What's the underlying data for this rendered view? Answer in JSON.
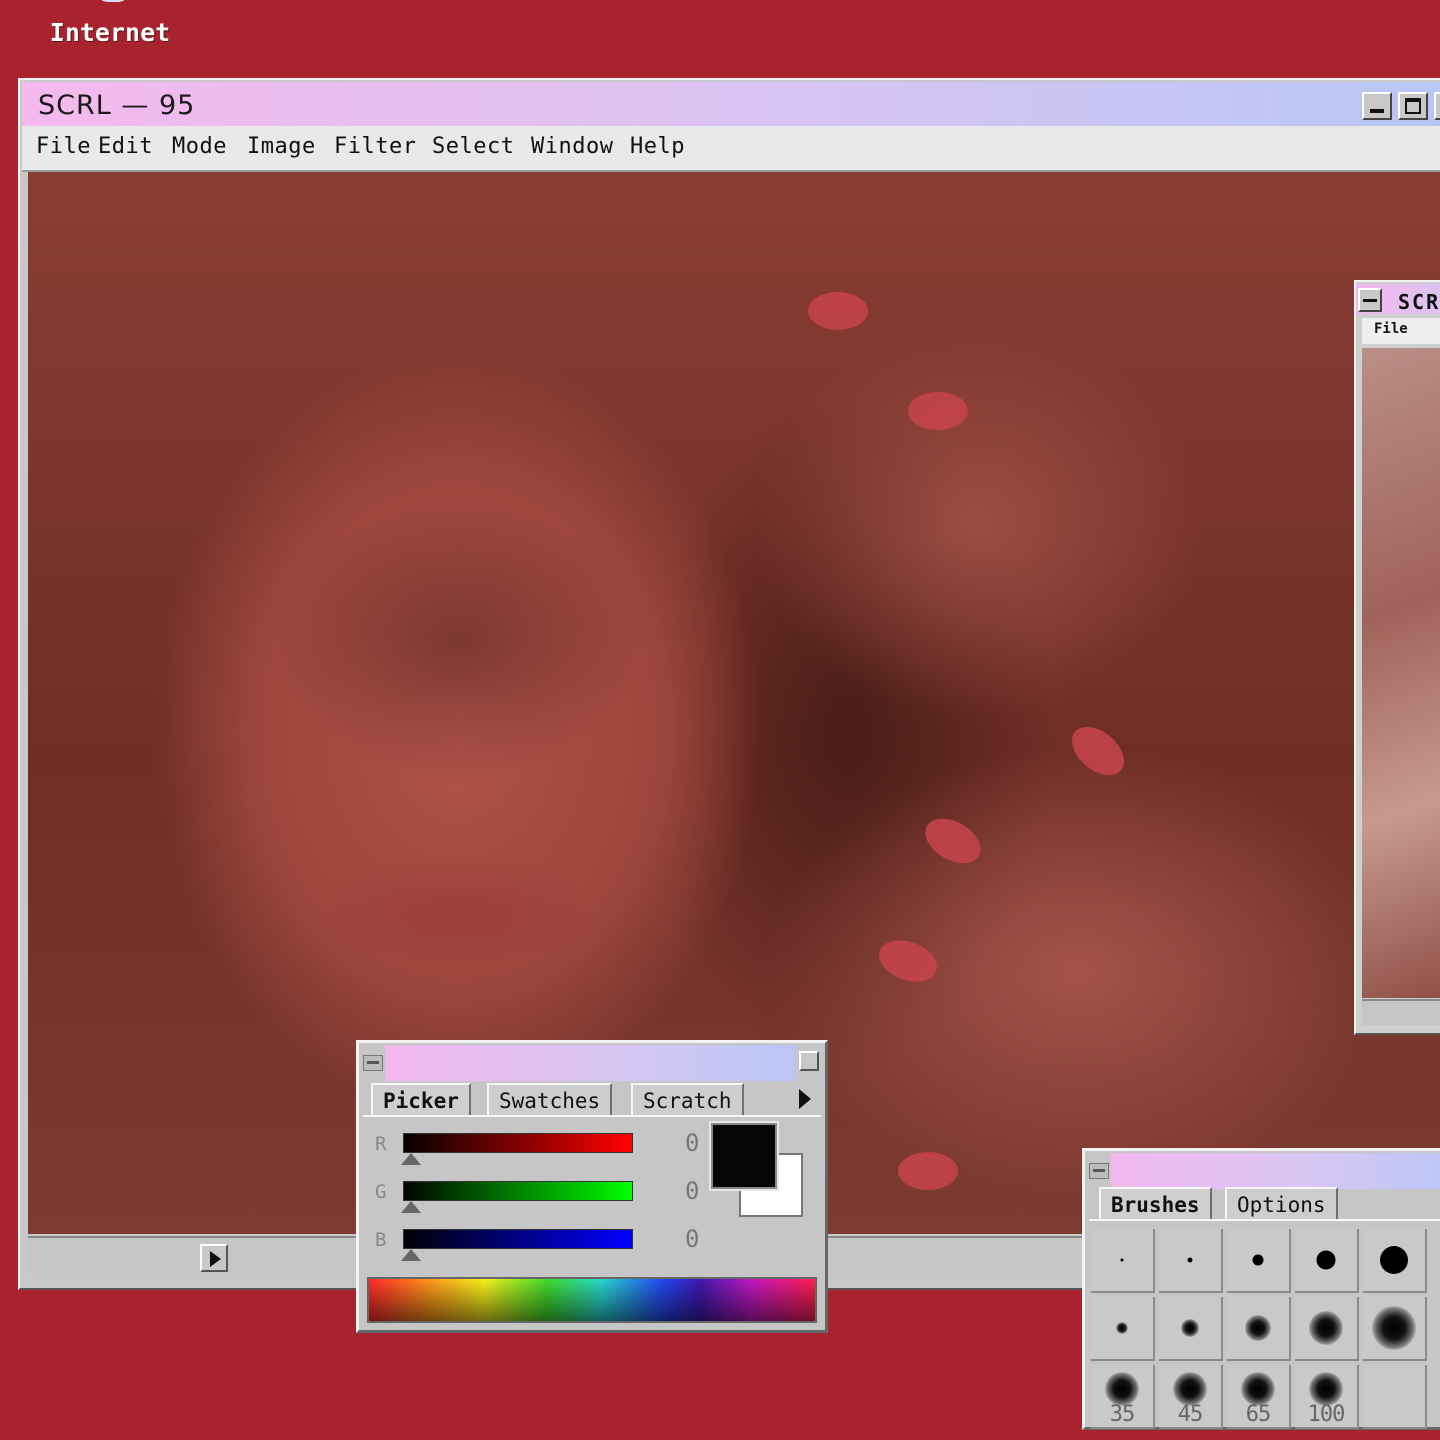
{
  "desktop": {
    "icon_label": "Internet",
    "icon": "globe-icon"
  },
  "window": {
    "title": "SCRL — 95",
    "menu": [
      "File",
      "Edit",
      "Mode",
      "Image",
      "Filter",
      "Select",
      "Window",
      "Help"
    ]
  },
  "second_window": {
    "title": "SCR",
    "menu_file": "File"
  },
  "color_palette": {
    "tabs": [
      "Picker",
      "Swatches",
      "Scratch"
    ],
    "channels": [
      {
        "label": "R",
        "value": "0",
        "color": "#ff0000"
      },
      {
        "label": "G",
        "value": "0",
        "color": "#00ff00"
      },
      {
        "label": "B",
        "value": "0",
        "color": "#0000ff"
      }
    ],
    "foreground": "#000000",
    "background": "#ffffff"
  },
  "brushes_palette": {
    "tabs": [
      "Brushes",
      "Options"
    ],
    "sizes_row3": [
      "35",
      "45",
      "65",
      "100"
    ]
  }
}
